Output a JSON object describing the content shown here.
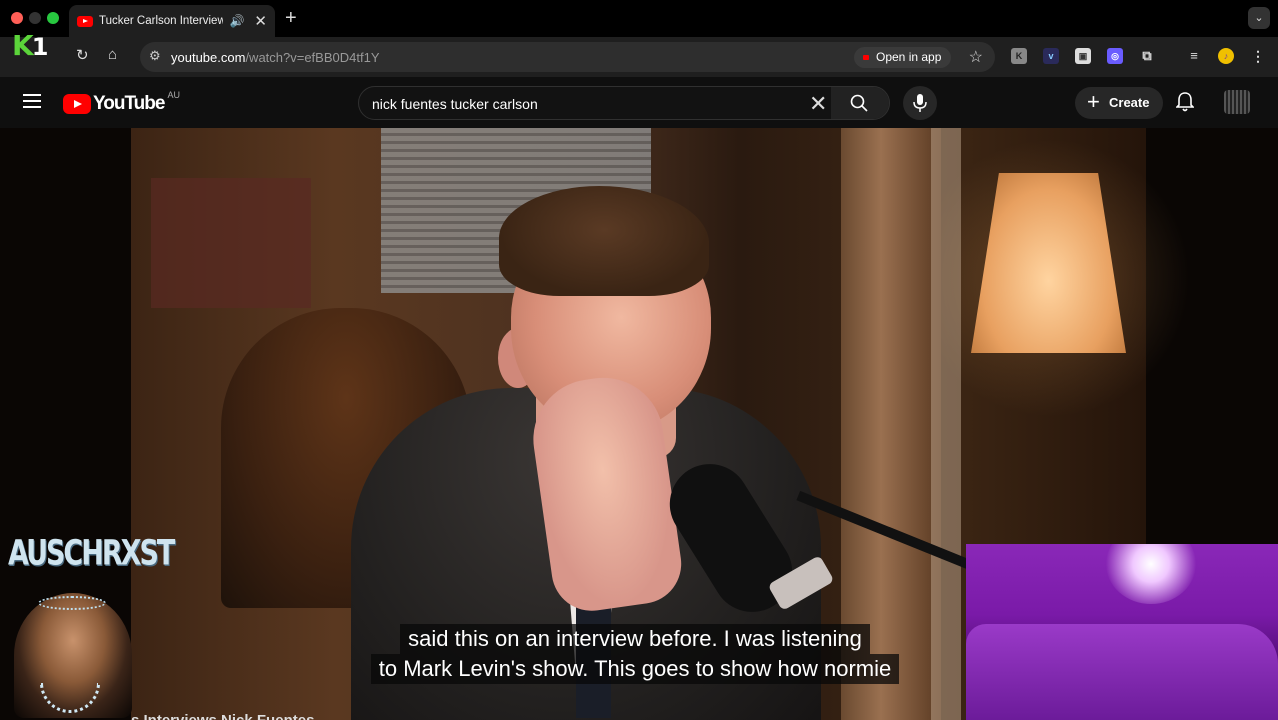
{
  "browser": {
    "tab_title": "Tucker Carlson Interviews Nick Fuentes",
    "url_host": "youtube.com",
    "url_path": "/watch?v=efBB0D4tf1Y",
    "open_in_app": "Open in app"
  },
  "overlay_logo": {
    "k": "K",
    "one": "1"
  },
  "youtube": {
    "logo_text": "YouTube",
    "region": "AU",
    "search_query": "nick fuentes tucker carlson",
    "create_label": "Create"
  },
  "video": {
    "caption_line1": "said this on an interview before. I was listening",
    "caption_line2": "to Mark Levin's show. This goes to show how normie",
    "stream_overlay_text": "AUSCHRXST",
    "title_partial": "s Interviews Nick Fuentes"
  },
  "colors": {
    "yt_red": "#ff0000",
    "k1_green": "#5bd43a",
    "webcam_purple": "#8a28b8"
  }
}
